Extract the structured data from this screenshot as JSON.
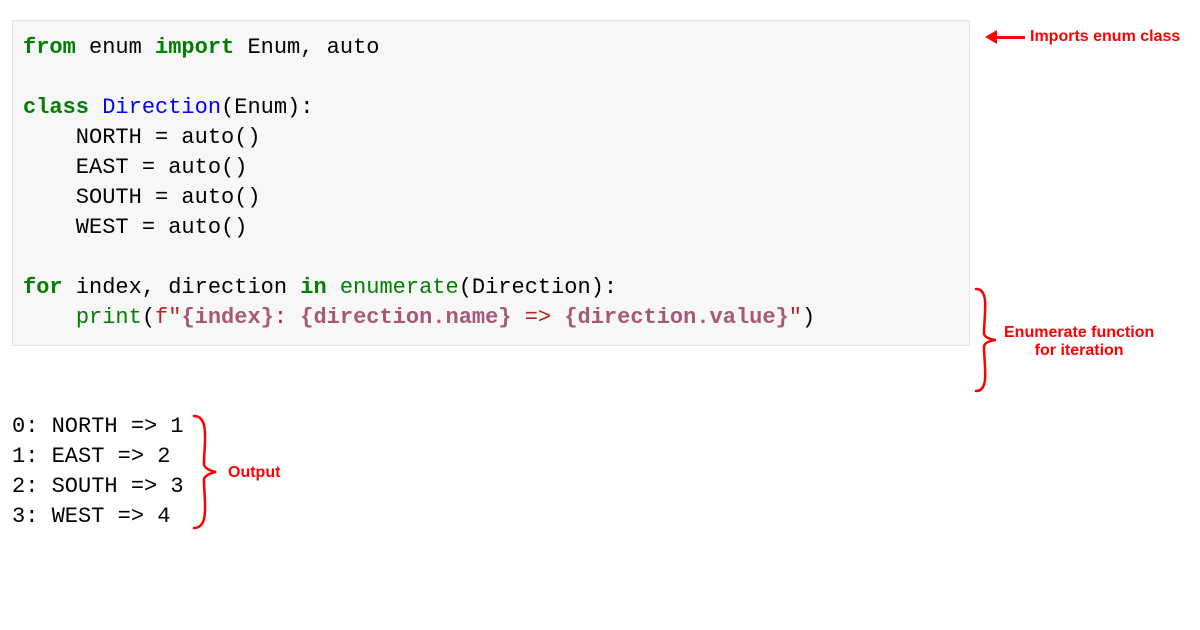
{
  "code": {
    "l1": {
      "kw_from": "from",
      "mod_enum": " enum ",
      "kw_import": "import",
      "rest": " Enum, auto"
    },
    "l2": "",
    "l3": {
      "kw_class": "class",
      "sp": " ",
      "cls_name": "Direction",
      "rest": "(Enum):"
    },
    "l4": "    NORTH = auto()",
    "l5": "    EAST = auto()",
    "l6": "    SOUTH = auto()",
    "l7": "    WEST = auto()",
    "l8": "",
    "l9": {
      "kw_for": "for",
      "mid": " index, direction ",
      "kw_in": "in",
      "sp": " ",
      "fn_enum": "enumerate",
      "rest": "(Direction):"
    },
    "l10": {
      "indent": "    ",
      "fn_print": "print",
      "paren_open": "(",
      "s1": "f\"",
      "i1": "{index}",
      "s2": ": ",
      "i2": "{direction.name}",
      "s3": " => ",
      "i3": "{direction.value}",
      "s4": "\"",
      "paren_close": ")"
    }
  },
  "output": {
    "l1": "0: NORTH => 1",
    "l2": "1: EAST => 2",
    "l3": "2: SOUTH => 3",
    "l4": "3: WEST => 4"
  },
  "annotations": {
    "a1": "Imports enum class",
    "a2_line1": "Enumerate function",
    "a2_line2": "for iteration",
    "a3": "Output"
  }
}
